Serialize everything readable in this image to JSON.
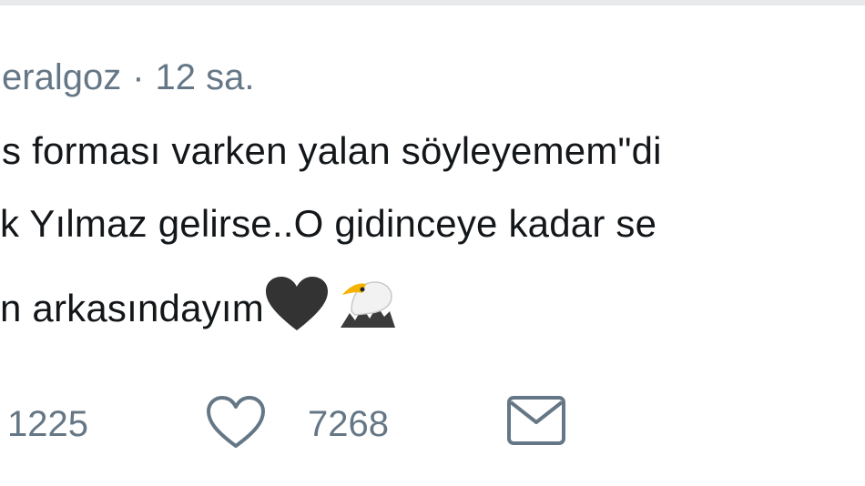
{
  "tweet": {
    "username_fragment": "eralgoz",
    "separator": "·",
    "time": "12 sa.",
    "lines": [
      "s forması varken yalan söyleyemem\"di",
      "k Yılmaz gelirse..O gidinceye kadar se",
      "n arkasındayım"
    ],
    "emojis": [
      "black-heart-icon",
      "eagle-icon"
    ]
  },
  "actions": {
    "retweet_count": "1225",
    "like_count": "7268"
  },
  "colors": {
    "text": "#14171a",
    "muted": "#657786",
    "divider": "#e7e9ea"
  }
}
